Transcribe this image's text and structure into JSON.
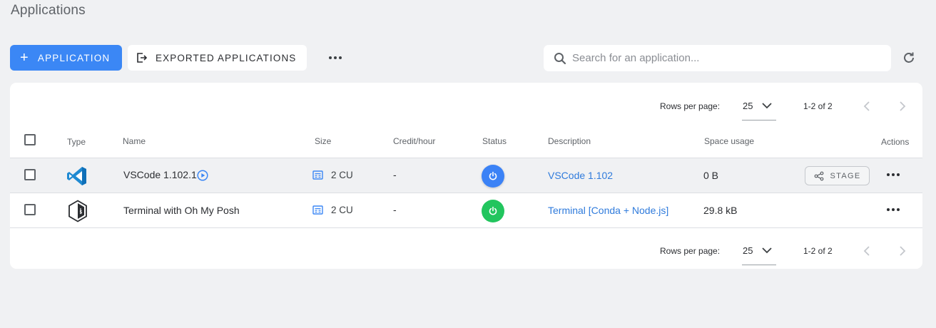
{
  "page": {
    "title": "Applications"
  },
  "toolbar": {
    "add_label": "APPLICATION",
    "exported_label": "EXPORTED APPLICATIONS",
    "search_placeholder": "Search for an application..."
  },
  "pagination": {
    "rows_per_page_label": "Rows per page:",
    "rows_per_page_value": "25",
    "range": "1-2 of 2"
  },
  "table": {
    "columns": {
      "type": "Type",
      "name": "Name",
      "size": "Size",
      "credit": "Credit/hour",
      "status": "Status",
      "description": "Description",
      "space": "Space usage",
      "actions": "Actions"
    },
    "rows": [
      {
        "type_icon": "vscode-icon",
        "name": "VSCode 1.102.1",
        "size": "2 CU",
        "credit": "-",
        "status_color": "#3b82f6",
        "description": "VSCode 1.102",
        "space": "0 B",
        "stage_label": "STAGE"
      },
      {
        "type_icon": "terminal-icon",
        "name": "Terminal with Oh My Posh",
        "size": "2 CU",
        "credit": "-",
        "status_color": "#22c55e",
        "description": "Terminal [Conda + Node.js]",
        "space": "29.8 kB"
      }
    ]
  },
  "colors": {
    "primary": "#3b87f5",
    "link": "#2f7bdc",
    "background": "#f0f1f3"
  }
}
